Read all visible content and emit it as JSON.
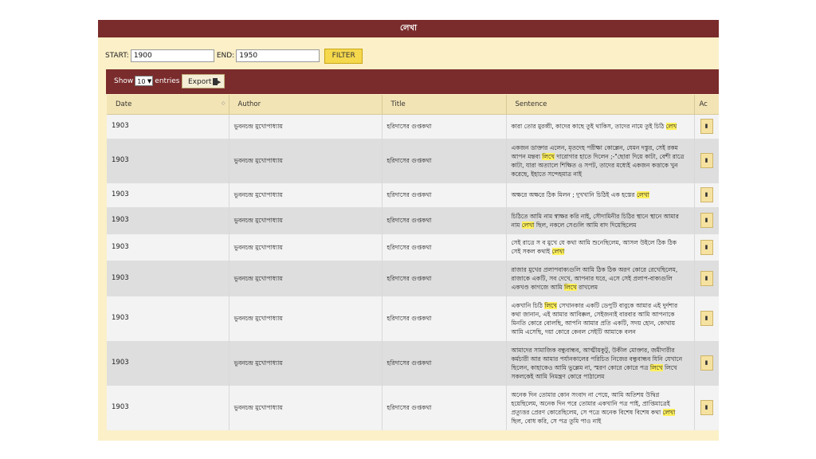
{
  "header": {
    "title": "লেখা"
  },
  "filter": {
    "start_label": "START:",
    "start_value": "1900",
    "end_label": "END:",
    "end_value": "1950",
    "button_label": "FILTER"
  },
  "table_controls": {
    "show_label": "Show",
    "entries_value": "10",
    "entries_label": "entries",
    "export_label": "Export"
  },
  "columns": [
    "Date",
    "Author",
    "Title",
    "Sentence",
    "Ac"
  ],
  "rows": [
    {
      "date": "1903",
      "author": "ভুবনচন্দ্র মুখোপাধ্যায়",
      "title": "হরিদাসের গুপ্তকথা",
      "sentence": [
        {
          "t": "কারা তোর মুরব্বী, কাদের কাছে তুই থাকিস, তাদের নামে তুই চিঠি "
        },
        {
          "t": "লেখ",
          "hl": true
        }
      ],
      "height": 30
    },
    {
      "date": "1903",
      "author": "ভুবনচন্দ্র মুখোপাধ্যায়",
      "title": "হরিদাসের গুপ্তকথা",
      "sentence": [
        {
          "t": "একজন ডাক্তার এলেন, মৃতদেহ পরীক্ষা কোল্লেন, যেমন দস্তুর, সেই রকম আপন মন্তব্য "
        },
        {
          "t": "লিখে",
          "hl": true
        },
        {
          "t": " দারোগার হাতে দিলেন ;-\"ছোরা দিয়ে কাটা, বেশী রাত্রে কাটা, যারা অত্যালে শিক্ষিত ও সপট, তাদের মধ্যেই একজন কত্তাকে খুন করেছে, ইহাতে সন্দেহমাত্র নাই"
        }
      ],
      "height": 56
    },
    {
      "date": "1903",
      "author": "ভুবনচন্দ্র মুখোপাধ্যায়",
      "title": "হরিদাসের গুপ্তকথা",
      "sentence": [
        {
          "t": "অক্ষরে অক্ষরে ঠিক মিলন ; দুখখানি চিঠিই এক হস্তের "
        },
        {
          "t": "লেখা",
          "hl": true
        }
      ],
      "height": 30
    },
    {
      "date": "1903",
      "author": "ভুবনচন্দ্র মুখোপাধ্যায়",
      "title": "হরিদাসের গুপ্তকথা",
      "sentence": [
        {
          "t": "চিঠিতে আমি নাম স্বাক্ষর করি নাই, সৌদামিনীর চিঠির স্থানে স্থানে আমার নাম "
        },
        {
          "t": "লেখা",
          "hl": true
        },
        {
          "t": " ছিল, নকলে সেগুলি আমি বাদ দিয়েছিলেম"
        }
      ],
      "height": 34
    },
    {
      "date": "1903",
      "author": "ভুবনচন্দ্র মুখোপাধ্যায়",
      "title": "হরিদাসের গুপ্তকথা",
      "sentence": [
        {
          "t": "সেই রাত্রে স ব মুখে যে কথা আমি শুনেছিলেম, আসল উইলে ঠিক ঠিক সেই সকল কথাই "
        },
        {
          "t": "লেখা",
          "hl": true
        }
      ],
      "height": 33
    },
    {
      "date": "1903",
      "author": "ভুবনচন্দ্র মুখোপাধ্যায়",
      "title": "হরিদাসের গুপ্তকথা",
      "sentence": [
        {
          "t": "রাজার মুখের প্রলাপবাক্যগুলি আমি ঠিক ঠিক অরণ কোরে রেখেছিলেম, রাজাকে একটি, সব দেখে, আপনার ঘরে, এসে সেই প্রলাপ-বাক্যগুলি একখণ্ড কাগজে আমি "
        },
        {
          "t": "লিখে",
          "hl": true
        },
        {
          "t": " রাখলেম"
        }
      ],
      "height": 45
    },
    {
      "date": "1903",
      "author": "ভুবনচন্দ্র মুখোপাধ্যায়",
      "title": "হরিদাসের গুপ্তকথা",
      "sentence": [
        {
          "t": "একখানি চিঠি "
        },
        {
          "t": "লিখে",
          "hl": true
        },
        {
          "t": " সেখানকার একটি ডেপুটি বাবুকে আমার এই দুর্দশার কথা জানান, এই আমার আবিক্কল, সেইজন্যই বারবার আমি আপনাকে মিনতি কোরে বোলছি, আপনি আমার প্রতি একটি, সদয় হোন, কোথায় আমি এসেছি, দয়া কোরে কেবল সেইটি আমাকে বলন"
        }
      ],
      "height": 56
    },
    {
      "date": "1903",
      "author": "ভুবনচন্দ্র মুখোপাধ্যায়",
      "title": "হরিদাসের গুপ্তকথা",
      "sentence": [
        {
          "t": "আমাদের সামাজিক বন্ধুবান্ধব, আত্মীয়কুটু, উকীল মোক্তার, জমীদারীর কর্মচারী আর আমার পর্যানকালের পরিচিত নিজের বন্ধুবান্ধব যিনি যেখানে ছিলেন, কাহাকেও আমি ভুল্লেম না, স্মরণ কোরে কোরে পত্র "
        },
        {
          "t": "লিখে",
          "hl": true
        },
        {
          "t": " লিখে সকলকেই আমি নিমন্ত্রণ কোরে পাঠালেম"
        }
      ],
      "height": 56
    },
    {
      "date": "1903",
      "author": "ভুবনচন্দ্র মুখোপাধ্যায়",
      "title": "হরিদাসের গুপ্তকথা",
      "sentence": [
        {
          "t": "অনেক দিন তোমার কোন সংবাদ না পেয়ে, আমি অতিশয় উদ্বিগ্ন হয়েছিলেম, অনেক দিন পরে তোমার একখানি পত্র পাই, প্রাপ্তিমাত্রেই প্রত্যুত্তর প্রেরণ কোরেছিলেম, সে পত্রে অনেক বিশেষ বিশেষ কথা "
        },
        {
          "t": "লেখা",
          "hl": true
        },
        {
          "t": " ছিল, বোধ করি, সে পত্র তুমি পাও নাই"
        }
      ],
      "height": 56
    }
  ]
}
